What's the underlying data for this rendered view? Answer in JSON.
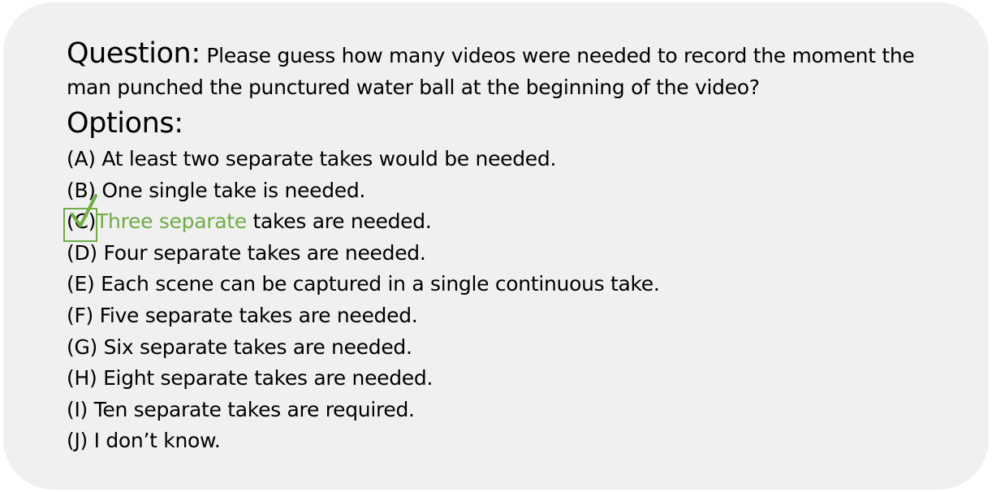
{
  "question": {
    "heading": "Question:",
    "text": "Please guess how many videos were needed to record the moment the man punched the punctured water ball at the beginning of the video?"
  },
  "options_heading": "Options:",
  "options": [
    {
      "letter": "(A)",
      "highlight": "",
      "text": "At least two separate takes would be needed."
    },
    {
      "letter": "(B)",
      "highlight": "",
      "text": "One single take is needed."
    },
    {
      "letter": "(C)",
      "highlight": "Three separate",
      "text": " takes are needed.",
      "checked": true
    },
    {
      "letter": "(D)",
      "highlight": "",
      "text": "Four separate takes are needed."
    },
    {
      "letter": "(E)",
      "highlight": "",
      "text": "Each scene can be captured in a single continuous take."
    },
    {
      "letter": "(F)",
      "highlight": "",
      "text": "Five separate takes are needed."
    },
    {
      "letter": "(G)",
      "highlight": "",
      "text": "Six separate takes are needed."
    },
    {
      "letter": "(H)",
      "highlight": "",
      "text": "Eight separate takes are needed."
    },
    {
      "letter": "(I)",
      "highlight": "",
      "text": "Ten separate takes are required."
    },
    {
      "letter": "(J)",
      "highlight": "",
      "text": "I don’t know."
    }
  ],
  "colors": {
    "card_background": "#f0f0f0",
    "correct_answer": "#70ad47",
    "text": "#000000"
  },
  "icons": {
    "correct_marker": "checkmark-icon"
  }
}
